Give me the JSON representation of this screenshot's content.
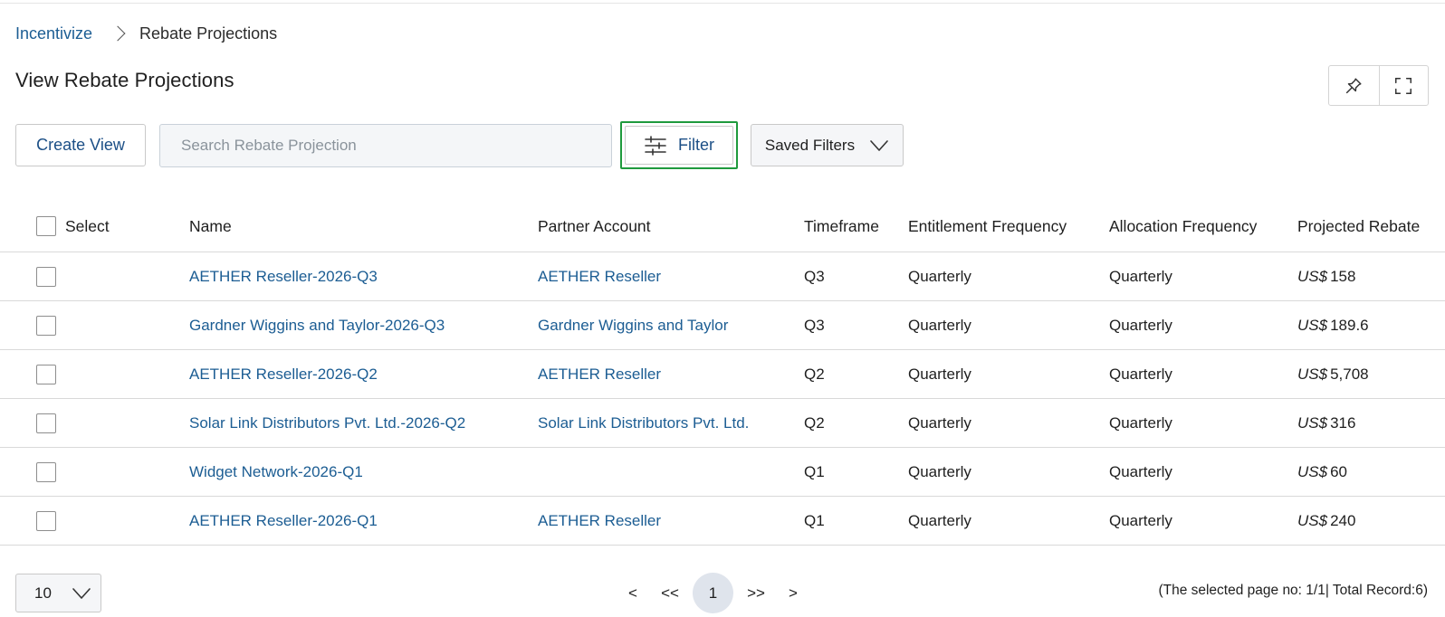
{
  "breadcrumb": {
    "root": "Incentivize",
    "current": "Rebate Projections"
  },
  "page_title": "View Rebate Projections",
  "toolbar": {
    "create_view_label": "Create View",
    "search_placeholder": "Search Rebate Projection",
    "filter_label": "Filter",
    "saved_filters_label": "Saved Filters"
  },
  "header_icons": [
    "pin-icon",
    "expand-icon"
  ],
  "table": {
    "columns": {
      "select": "Select",
      "name": "Name",
      "partner": "Partner Account",
      "timeframe": "Timeframe",
      "entitlement": "Entitlement Frequency",
      "allocation": "Allocation Frequency",
      "rebate": "Projected Rebate"
    },
    "rows": [
      {
        "name": "AETHER Reseller-2026-Q3",
        "partner": "AETHER Reseller",
        "timeframe": "Q3",
        "entitlement": "Quarterly",
        "allocation": "Quarterly",
        "currency": "US$",
        "rebate": "158"
      },
      {
        "name": "Gardner Wiggins and Taylor-2026-Q3",
        "partner": "Gardner Wiggins and Taylor",
        "timeframe": "Q3",
        "entitlement": "Quarterly",
        "allocation": "Quarterly",
        "currency": "US$",
        "rebate": "189.6"
      },
      {
        "name": "AETHER Reseller-2026-Q2",
        "partner": "AETHER Reseller",
        "timeframe": "Q2",
        "entitlement": "Quarterly",
        "allocation": "Quarterly",
        "currency": "US$",
        "rebate": "5,708"
      },
      {
        "name": "Solar Link Distributors Pvt. Ltd.-2026-Q2",
        "partner": "Solar Link Distributors Pvt. Ltd.",
        "timeframe": "Q2",
        "entitlement": "Quarterly",
        "allocation": "Quarterly",
        "currency": "US$",
        "rebate": "316"
      },
      {
        "name": "Widget Network-2026-Q1",
        "partner": "",
        "timeframe": "Q1",
        "entitlement": "Quarterly",
        "allocation": "Quarterly",
        "currency": "US$",
        "rebate": "60"
      },
      {
        "name": "AETHER Reseller-2026-Q1",
        "partner": "AETHER Reseller",
        "timeframe": "Q1",
        "entitlement": "Quarterly",
        "allocation": "Quarterly",
        "currency": "US$",
        "rebate": "240"
      }
    ]
  },
  "pagination": {
    "page_size": "10",
    "prev": "<",
    "first": "<<",
    "current_page": "1",
    "last": ">>",
    "next": ">",
    "info": "(The selected page no: 1/1| Total Record:6)"
  },
  "colors": {
    "link": "#1c5d93",
    "filter_highlight": "#1f9a3d",
    "current_page_bg": "#dfe4ec"
  }
}
